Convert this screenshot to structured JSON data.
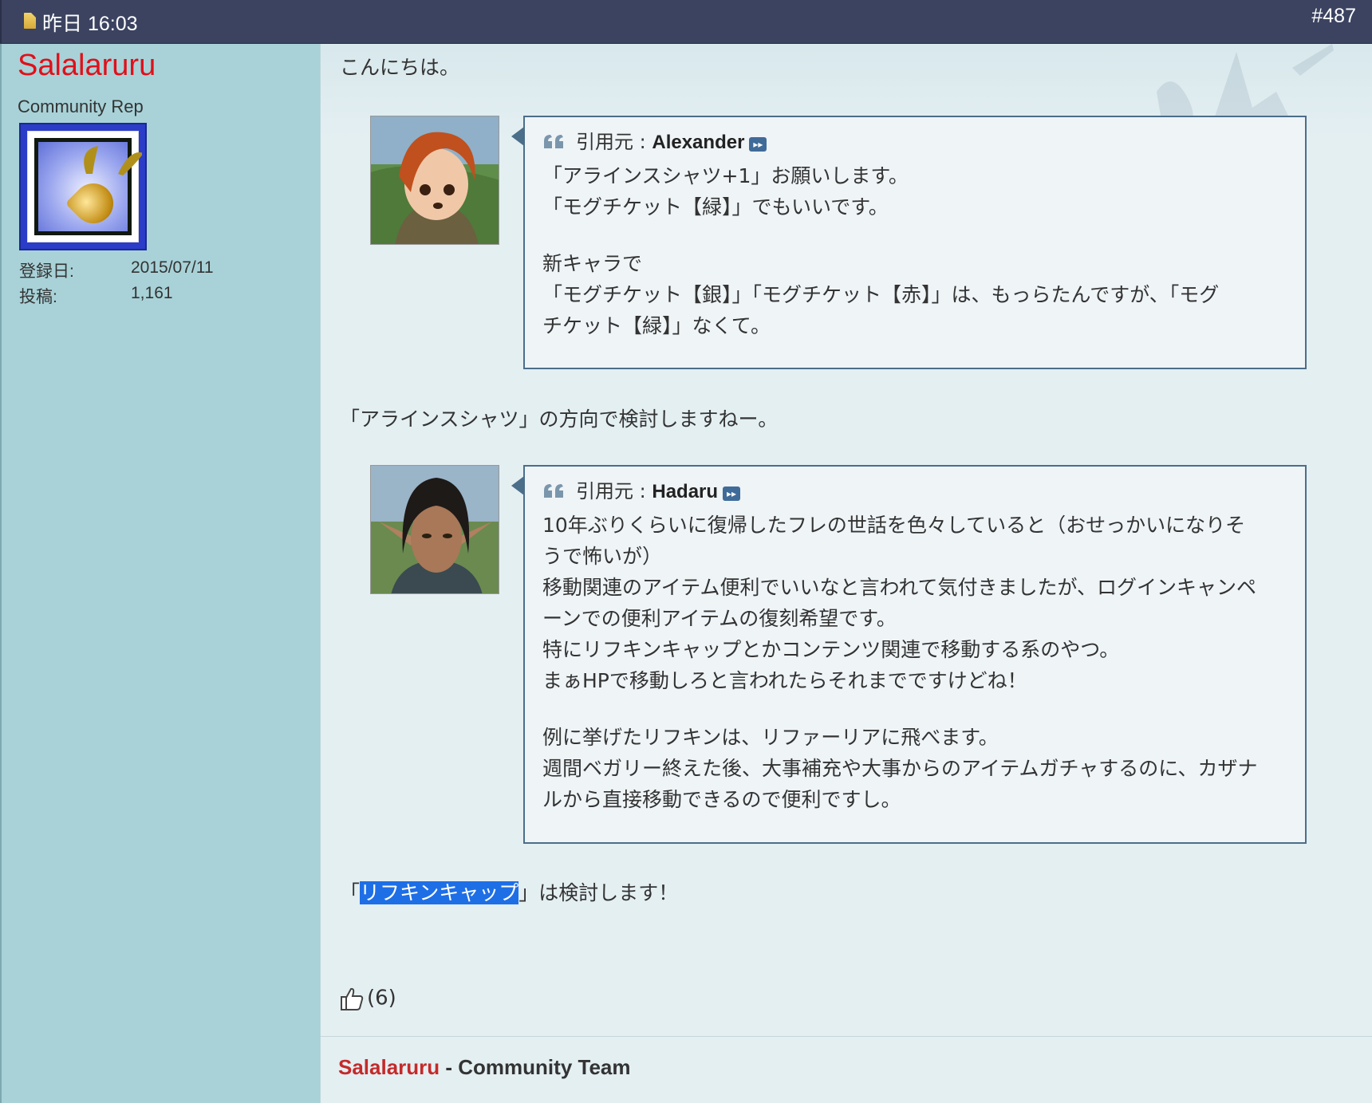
{
  "header": {
    "date": "昨日 16:03",
    "post_number": "#487"
  },
  "user": {
    "name": "Salalaruru",
    "title": "Community Rep",
    "stats": [
      {
        "label": "登録日:",
        "value": "2015/07/11"
      },
      {
        "label": "投稿:",
        "value": "1,161"
      }
    ]
  },
  "post": {
    "greeting": "こんにちは。",
    "quotes": [
      {
        "prefix": "引用元 :",
        "author": "Alexander",
        "lines": [
          "「アラインスシャツ+1」お願いします。",
          "「モグチケット【緑】」でもいいです。",
          "",
          "新キャラで",
          "「モグチケット【銀】」「モグチケット【赤】」は、もっらたんですが、「モグ",
          "チケット【緑】」なくて。"
        ]
      },
      {
        "prefix": "引用元 :",
        "author": "Hadaru",
        "lines": [
          "10年ぶりくらいに復帰したフレの世話を色々していると（おせっかいになりそ",
          "うで怖いが）",
          "移動関連のアイテム便利でいいなと言われて気付きましたが、ログインキャンペ",
          "ーンでの便利アイテムの復刻希望です。",
          "特にリフキンキャップとかコンテンツ関連で移動する系のやつ。",
          "まぁHPで移動しろと言われたらそれまでですけどね！",
          "",
          "例に挙げたリフキンは、リファーリアに飛べます。",
          "週間ベガリー終えた後、大事補充や大事からのアイテムガチャするのに、カザナ",
          "ルから直接移動できるので便利ですし。"
        ]
      }
    ],
    "reply1": "「アラインスシャツ」の方向で検討しますねー。",
    "reply2_open": "「",
    "reply2_selected": "リフキンキャップ",
    "reply2_rest": "」は検討します！",
    "likes": "(6)"
  },
  "signature": {
    "name": "Salalaruru",
    "team": " - Community Team"
  }
}
